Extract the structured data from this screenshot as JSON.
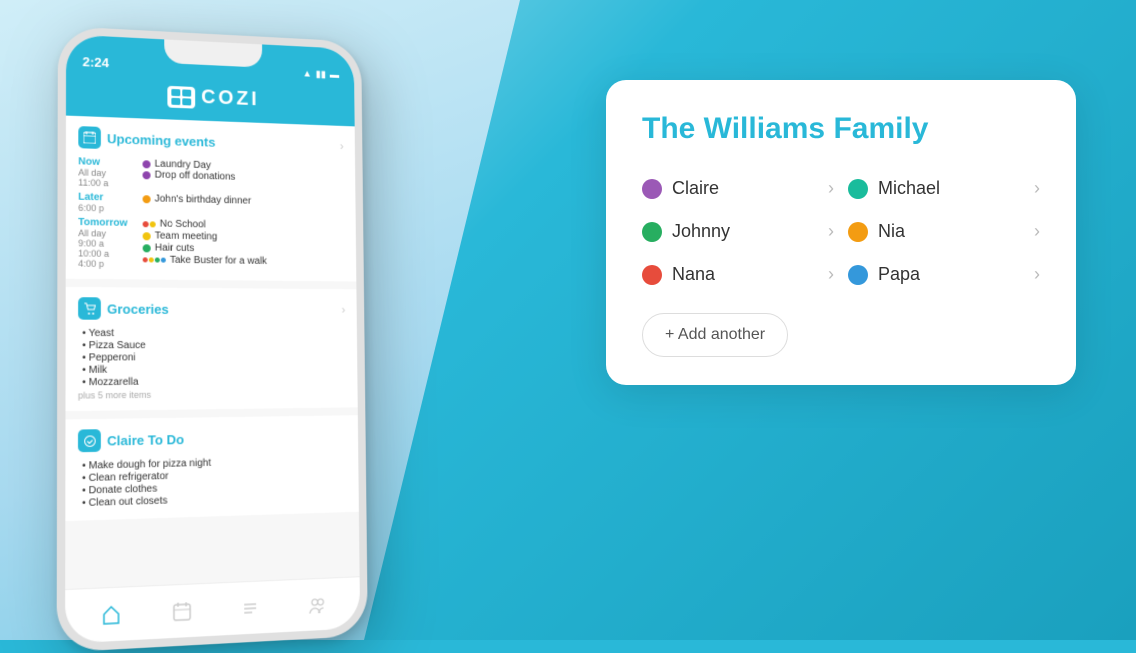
{
  "background": {
    "color": "#29b8d8"
  },
  "phone": {
    "status_time": "2:24",
    "app_name": "COZI",
    "sections": {
      "events": {
        "title": "Upcoming events",
        "now": {
          "label": "Now",
          "times": [
            "All day",
            "11:00 a"
          ],
          "items": [
            {
              "text": "Laundry Day",
              "color": "#8e44ad"
            },
            {
              "text": "Drop off donations",
              "color": "#8e44ad"
            }
          ]
        },
        "later": {
          "label": "Later",
          "times": [
            "6:00 p"
          ],
          "items": [
            {
              "text": "John's birthday dinner",
              "color": "#f39c12"
            }
          ]
        },
        "tomorrow": {
          "label": "Tomorrow",
          "times": [
            "All day",
            "9:00 a",
            "10:00 a",
            "4:00 p"
          ],
          "items": [
            {
              "text": "No School",
              "color": "#e74c3c"
            },
            {
              "text": "Team meeting",
              "color": "#f1c40f"
            },
            {
              "text": "Hair cuts",
              "color": "#27ae60"
            },
            {
              "text": "Take Buster for a walk",
              "colors": [
                "#e74c3c",
                "#f1c40f",
                "#27ae60",
                "#3498db"
              ]
            }
          ]
        }
      },
      "groceries": {
        "title": "Groceries",
        "items": [
          "Yeast",
          "Pizza Sauce",
          "Pepperoni",
          "Milk",
          "Mozzarella"
        ],
        "more": "plus 5 more items"
      },
      "todo": {
        "title": "Claire To Do",
        "items": [
          "Make dough for pizza night",
          "Clean refrigerator",
          "Donate clothes",
          "Clean out closets"
        ]
      }
    }
  },
  "family_card": {
    "title": "The Williams Family",
    "members": [
      {
        "name": "Claire",
        "color": "#9b59b6"
      },
      {
        "name": "Michael",
        "color": "#1abc9c"
      },
      {
        "name": "Johnny",
        "color": "#27ae60"
      },
      {
        "name": "Nia",
        "color": "#f39c12"
      },
      {
        "name": "Nana",
        "color": "#e74c3c"
      },
      {
        "name": "Papa",
        "color": "#3498db"
      }
    ],
    "add_button": "+ Add another",
    "arrow": "›"
  },
  "icons": {
    "calendar": "📅",
    "cart": "🛒",
    "check": "✓",
    "plus": "+"
  }
}
